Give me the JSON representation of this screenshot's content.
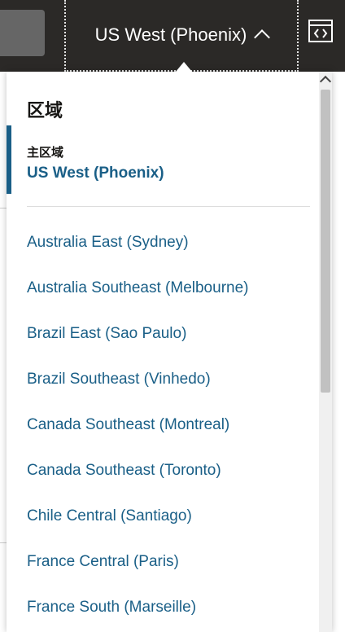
{
  "topbar": {
    "region_button_label": "US West (Phoenix)"
  },
  "dropdown": {
    "title": "区域",
    "home_region_label": "主区域",
    "home_region_value": "US West (Phoenix)",
    "regions": [
      "Australia East (Sydney)",
      "Australia Southeast (Melbourne)",
      "Brazil East (Sao Paulo)",
      "Brazil Southeast (Vinhedo)",
      "Canada Southeast (Montreal)",
      "Canada Southeast (Toronto)",
      "Chile Central (Santiago)",
      "France Central (Paris)",
      "France South (Marseille)"
    ]
  },
  "colors": {
    "topbar_bg": "#2b2927",
    "link": "#1a5f87",
    "home_marker": "#1a5f87"
  },
  "icons": {
    "region_chevron": "chevron-up-icon",
    "code_panel": "code-icon"
  }
}
